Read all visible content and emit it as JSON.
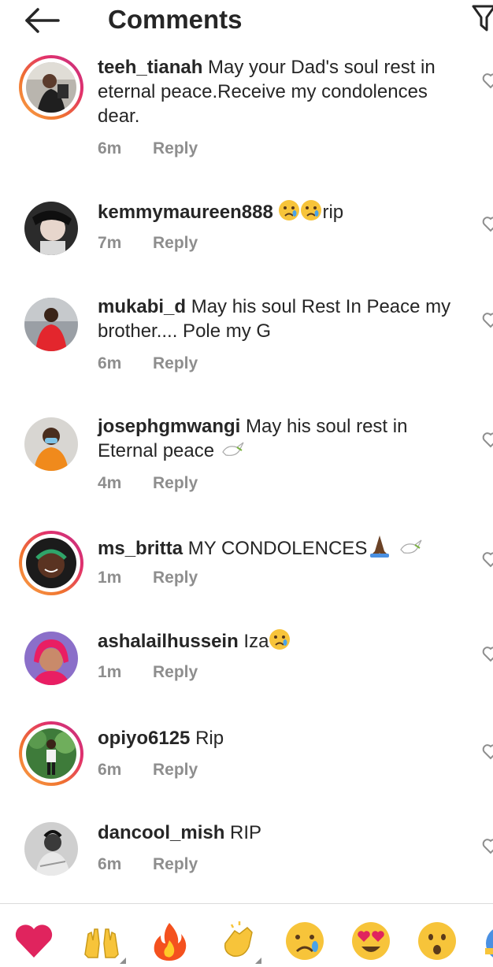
{
  "header": {
    "title": "Comments",
    "back_icon": "arrow-left-icon",
    "filter_icon": "filter-icon"
  },
  "comments": [
    {
      "username": "teeh_tianah",
      "text": "May your Dad's soul rest in eternal peace.Receive my condolences dear.",
      "time": "6m",
      "reply": "Reply"
    },
    {
      "username": "kemmymaureen888",
      "text": "rip",
      "time": "7m",
      "reply": "Reply"
    },
    {
      "username": "mukabi_d",
      "text": "May his soul Rest In Peace my brother.... Pole my G",
      "time": "6m",
      "reply": "Reply"
    },
    {
      "username": "josephgmwangi",
      "text": "May his soul rest in Eternal peace",
      "time": "4m",
      "reply": "Reply"
    },
    {
      "username": "ms_britta",
      "text": "MY CONDOLENCES",
      "time": "1m",
      "reply": "Reply"
    },
    {
      "username": "ashalailhussein",
      "text": "Iza",
      "time": "1m",
      "reply": "Reply"
    },
    {
      "username": "opiyo6125",
      "text": "Rip",
      "time": "6m",
      "reply": "Reply"
    },
    {
      "username": "dancool_mish",
      "text": "RIP",
      "time": "6m",
      "reply": "Reply"
    }
  ],
  "emoji_bar": [
    "red-heart",
    "raising-hands",
    "fire",
    "clapping-hands",
    "crying-face",
    "heart-eyes",
    "astonished-face",
    "partial-emoji"
  ],
  "colors": {
    "text": "#262626",
    "secondary": "#8e8e8e",
    "ring_orange": "#f0742f",
    "ring_pink": "#e1306c",
    "heart": "#e0245e"
  }
}
